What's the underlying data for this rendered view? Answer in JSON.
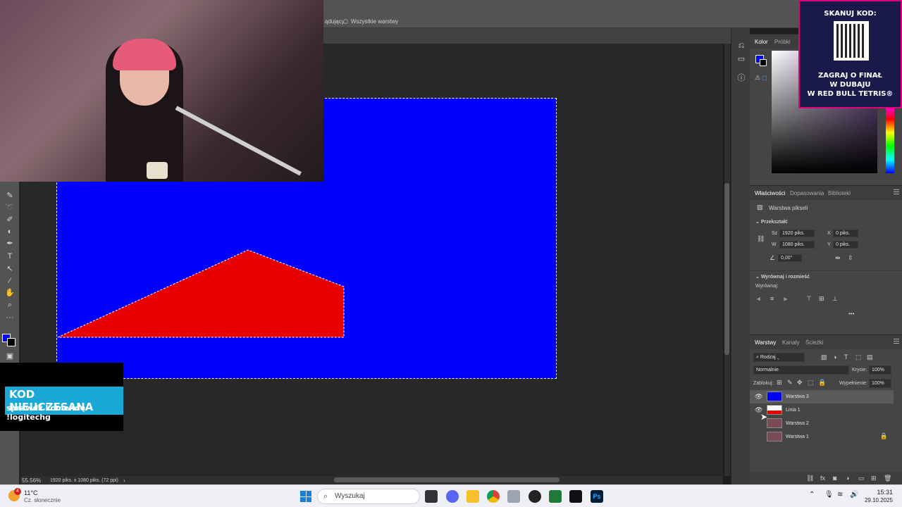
{
  "options_bar": {
    "partial_label": "ądujący",
    "all_layers_label": "Wszystkie warstwy"
  },
  "status": {
    "zoom": "55.56%",
    "doc_info": "1920 piks. x 1080 piks. (72 ppi)"
  },
  "color_panel": {
    "tabs": [
      "Kolor",
      "Próbki"
    ]
  },
  "properties_panel": {
    "tabs": [
      "Właściwości",
      "Dopasowania",
      "Biblioteki"
    ],
    "layer_type": "Warstwa pikseli",
    "transform_title": "Przekształć",
    "w_label": "Sz",
    "w_value": "1920 piks.",
    "h_label": "W",
    "h_value": "1080 piks.",
    "x_label": "X",
    "x_value": "0 piks.",
    "y_label": "Y",
    "y_value": "0 piks.",
    "angle_value": "0,00°",
    "align_title": "Wyrównaj i rozmieść",
    "align_label": "Wyrównaj:",
    "more": "•••"
  },
  "layers_panel": {
    "tabs": [
      "Warstwy",
      "Kanały",
      "Ścieżki"
    ],
    "filter_label": "Rodzaj",
    "blend_mode": "Normalnie",
    "opacity_label": "Krycie:",
    "opacity_value": "100%",
    "lock_label": "Zablokuj:",
    "fill_label": "Wypełnienie:",
    "fill_value": "100%",
    "layers": [
      {
        "name": "Warstwa 3",
        "visible": true,
        "selected": true
      },
      {
        "name": "Linia 1",
        "visible": true,
        "selected": false
      },
      {
        "name": "Warstwa 2",
        "visible": false,
        "selected": false
      },
      {
        "name": "Warstwa 1",
        "visible": false,
        "selected": false,
        "locked": true
      }
    ]
  },
  "promo": {
    "line1": "SKANUJ KOD:",
    "line2": "ZAGRAJ O FINAŁ",
    "line3": "W DUBAJU",
    "line4": "W RED BULL TETRIS®"
  },
  "kod": {
    "title": "KOD NIEUCZESANA",
    "subtitle": "sprawdź komendę !logitechg"
  },
  "taskbar": {
    "weather_temp": "11°C",
    "weather_desc": "Cz. słonecznie",
    "badge": "4",
    "search_placeholder": "Wyszukaj",
    "time": "15:31",
    "date": "29.10.2025"
  },
  "colors": {
    "canvas": "#0000ff",
    "shape": "#e60000",
    "promo_border": "#e0007a",
    "kod_accent": "#19a8d8"
  }
}
